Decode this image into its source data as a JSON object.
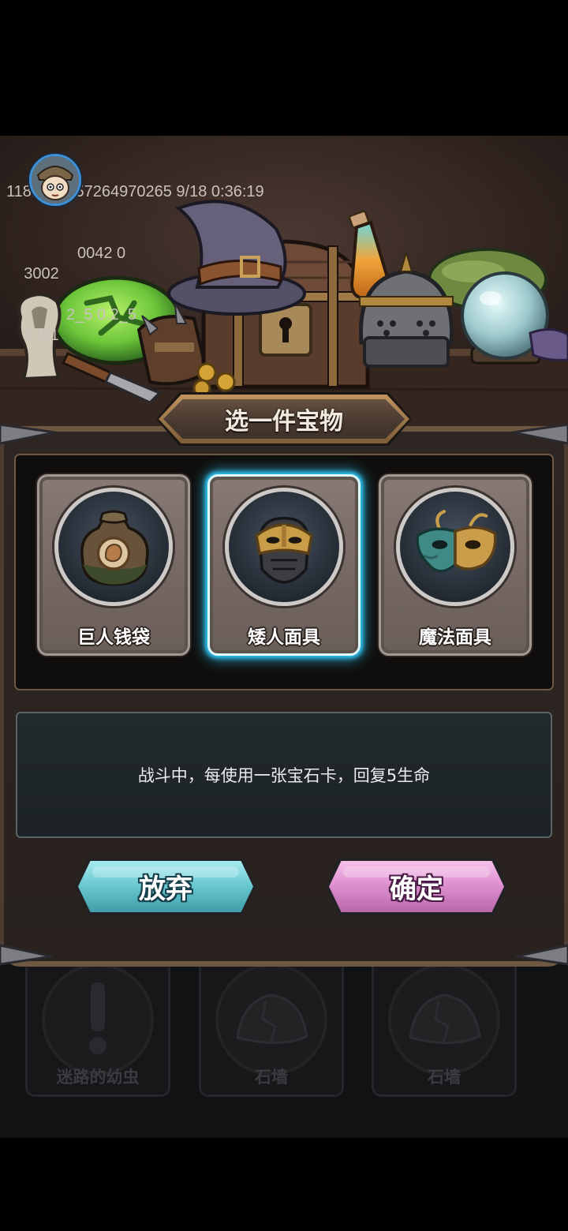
{
  "debug_overlay": {
    "line1": "1181098057264970265 9/18 0:36:19",
    "line2_start": "3002",
    "line2_end": "0042 0",
    "line3_start": "2391",
    "line3_end": "2_5 0.2_5"
  },
  "avatar": {
    "icon": "player-avatar-icon"
  },
  "title": "选一件宝物",
  "treasures": [
    {
      "name": "巨人钱袋",
      "icon": "giant-money-bag-icon",
      "selected": false
    },
    {
      "name": "矮人面具",
      "icon": "dwarf-mask-icon",
      "selected": true
    },
    {
      "name": "魔法面具",
      "icon": "magic-mask-icon",
      "selected": false
    }
  ],
  "description": "战斗中，每使用一张宝石卡，回复5生命",
  "buttons": {
    "abandon": "放弃",
    "confirm": "确定"
  },
  "background_cards": [
    {
      "name": "迷路的幼虫",
      "icon": "exclamation-icon"
    },
    {
      "name": "石墙",
      "icon": "cracked-rock-icon"
    },
    {
      "name": "石墙",
      "icon": "cracked-rock-icon"
    }
  ],
  "colors": {
    "selection_glow": "#2fcfff",
    "abandon_button": "#6ccad2",
    "confirm_button": "#df92d0",
    "panel": "#2b2421",
    "title_text": "#f3eadf"
  }
}
